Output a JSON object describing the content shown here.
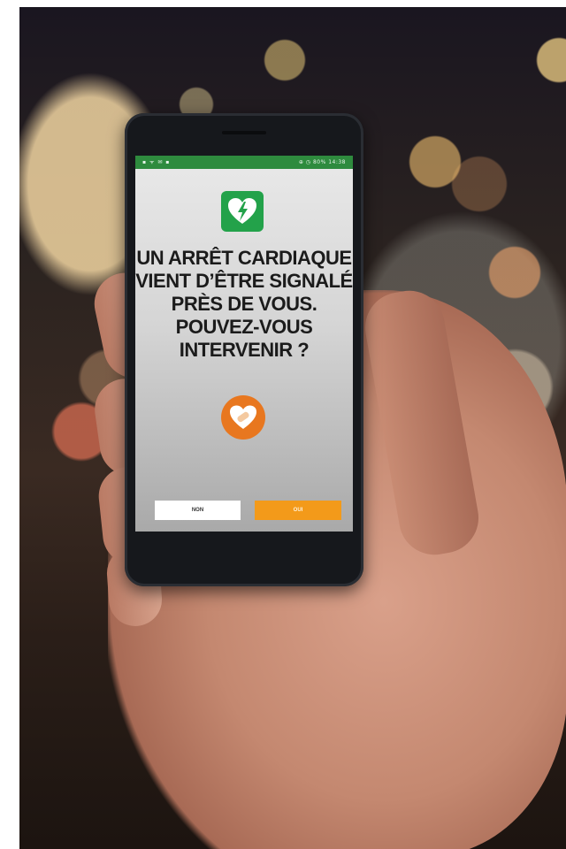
{
  "status_bar": {
    "left_icons": "▪ ᯤ ✉ ▪",
    "right_text": "⊕ ◷ 80% 14:38"
  },
  "alert": {
    "lines": [
      "UN ARRÊT CARDIAQUE",
      "VIENT D’ÊTRE SIGNALÉ",
      "PRÈS DE VOUS.",
      "POUVEZ-VOUS",
      "INTERVENIR ?"
    ]
  },
  "buttons": {
    "no_label": "NON",
    "yes_label": "OUI"
  },
  "icons": {
    "top": "defibrillator-heart-icon",
    "middle": "heart-bandage-icon"
  },
  "colors": {
    "status_green": "#2e8b3e",
    "aed_green": "#23a24a",
    "accent_orange": "#f39a1a",
    "heart_orange": "#e8771f"
  }
}
